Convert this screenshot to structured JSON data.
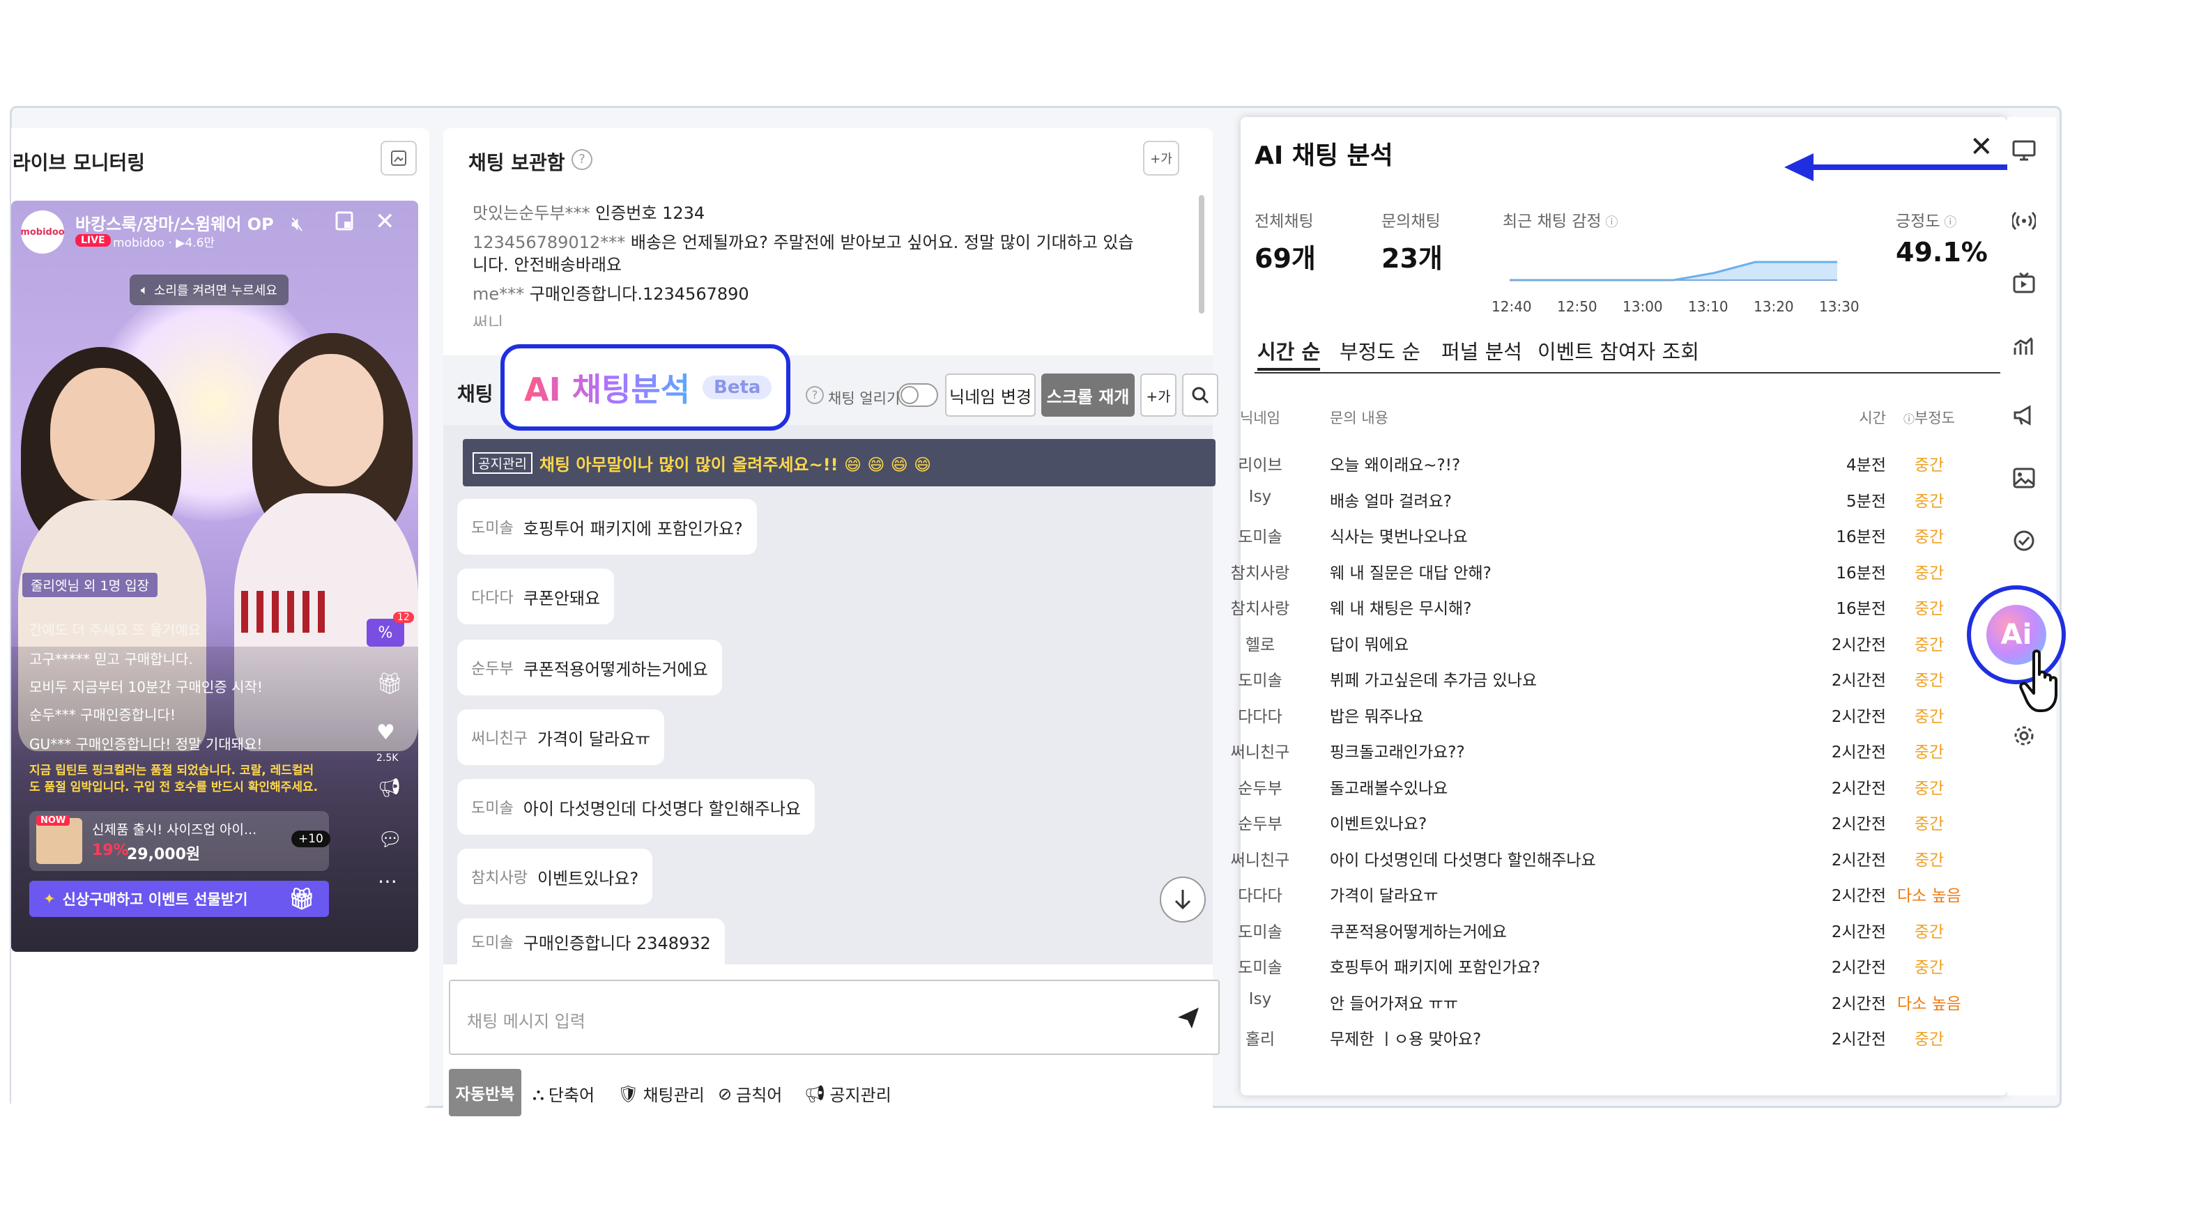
{
  "live": {
    "title": "라이브 모니터링",
    "stream_title": "바캉스룩/장마/스윔웨어 OP",
    "badge_live": "LIVE",
    "channel": "mobidoo · ▶4.6만",
    "logo_text": "mobidoo",
    "sound_hint": "소리를 켜려면 누르세요",
    "entry_note": "줄리엣님 외 1명 입장",
    "chats": [
      "간예도 더 주세요 또 올거예요",
      "고구*****  믿고 구매합니다.",
      "모비두  지금부터 10분간 구매인증 시작!",
      "순두***  구매인증합니다!",
      "GU***  구매인증합니다! 정말 기대돼요!"
    ],
    "notice": "지금 립틴트 핑크컬러는 품절 되었습니다. 코랄, 레드컬러도 품절 임박입니다. 구입 전 호수를 반드시 확인해주세요.",
    "badge_count": "12",
    "like_count": "2.5K",
    "product_new": "NOW",
    "product_name": "신제품 출시! 사이즈업 아이...",
    "product_discount": "19%",
    "product_price": "29,000원",
    "product_more": "+10",
    "event_button": "신상구매하고 이벤트 선물받기"
  },
  "chat_box": {
    "title": "채팅 보관함",
    "add_button": "+가",
    "messages": [
      {
        "nick": "맛있는순두부***",
        "text": "인증번호 1234"
      },
      {
        "nick": "123456789012***",
        "text": "배송은 언제될까요? 주말전에 받아보고 싶어요. 정말 많이 기대하고 있습니다. 안전배송바래요"
      },
      {
        "nick": "me***",
        "text": "구매인증합니다.1234567890"
      },
      {
        "nick": "써니",
        "text": ""
      }
    ]
  },
  "chat": {
    "title": "채팅",
    "ai_button": "AI 채팅분석",
    "beta": "Beta",
    "freeze_label": "채팅 얼리기",
    "nickname_button": "닉네임 변경",
    "scroll_button": "스크롤 재개",
    "font_button": "+가",
    "notice_tag": "공지관리",
    "notice_text": "채팅 아무말이나 많이 많이 올려주세요~!! 😄 😄 😄 😄",
    "bubbles": [
      {
        "nick": "도미솔",
        "text": "호핑투어 패키지에 포함인가요?"
      },
      {
        "nick": "다다다",
        "text": "쿠폰안돼요"
      },
      {
        "nick": "순두부",
        "text": "쿠폰적용어떻게하는거에요"
      },
      {
        "nick": "써니친구",
        "text": "가격이 달라요ㅠ"
      },
      {
        "nick": "도미솔",
        "text": "아이 다섯명인데 다섯명다 할인해주나요"
      },
      {
        "nick": "참치사랑",
        "text": "이벤트있나요?"
      },
      {
        "nick": "도미솔",
        "text": "구매인증합니다 2348932"
      }
    ],
    "input_placeholder": "채팅 메시지 입력",
    "bottom": {
      "auto_repeat": "자동반복",
      "shortcut": "단축어",
      "manage": "채팅관리",
      "banned": "금칙어",
      "notice": "공지관리"
    }
  },
  "ai": {
    "title": "AI 채팅 분석",
    "stats": {
      "total_label": "전체채팅",
      "total_value": "69개",
      "inquiry_label": "문의채팅",
      "inquiry_value": "23개",
      "sentiment_label": "최근 채팅 감정",
      "positive_label": "긍정도",
      "positive_value": "49.1%"
    },
    "sentiment_ticks": [
      "12:40",
      "12:50",
      "13:00",
      "13:10",
      "13:20",
      "13:30"
    ],
    "sentiment_series": [
      0,
      0,
      0,
      0,
      0,
      0.4,
      1,
      1,
      1
    ],
    "tabs": [
      "시간 순",
      "부정도 순",
      "퍼널 분석",
      "이벤트 참여자 조회"
    ],
    "columns": {
      "nick": "닉네임",
      "msg": "문의 내용",
      "time": "시간",
      "neg": "부정도"
    },
    "rows": [
      {
        "nick": "리이브",
        "msg": "오늘 왜이래요~?!?",
        "time": "4분전",
        "neg": "중간"
      },
      {
        "nick": "Isy",
        "msg": "배송 얼마 걸려요?",
        "time": "5분전",
        "neg": "중간"
      },
      {
        "nick": "도미솔",
        "msg": "식사는 몇번나오나요",
        "time": "16분전",
        "neg": "중간"
      },
      {
        "nick": "참치사랑",
        "msg": "웨 내 질문은 대답 안해?",
        "time": "16분전",
        "neg": "중간"
      },
      {
        "nick": "참치사랑",
        "msg": "웨 내 채팅은 무시해?",
        "time": "16분전",
        "neg": "중간"
      },
      {
        "nick": "헬로",
        "msg": "답이 뭐에요",
        "time": "2시간전",
        "neg": "중간"
      },
      {
        "nick": "도미솔",
        "msg": "뷔페 가고싶은데 추가금 있나요",
        "time": "2시간전",
        "neg": "중간"
      },
      {
        "nick": "다다다",
        "msg": "밥은 뭐주나요",
        "time": "2시간전",
        "neg": "중간"
      },
      {
        "nick": "써니친구",
        "msg": "핑크돌고래인가요??",
        "time": "2시간전",
        "neg": "중간"
      },
      {
        "nick": "순두부",
        "msg": "돌고래볼수있나요",
        "time": "2시간전",
        "neg": "중간"
      },
      {
        "nick": "순두부",
        "msg": "이벤트있나요?",
        "time": "2시간전",
        "neg": "중간"
      },
      {
        "nick": "써니친구",
        "msg": "아이 다섯명인데 다섯명다 할인해주나요",
        "time": "2시간전",
        "neg": "중간"
      },
      {
        "nick": "다다다",
        "msg": "가격이 달라요ㅠ",
        "time": "2시간전",
        "neg": "다소 높음"
      },
      {
        "nick": "도미솔",
        "msg": "쿠폰적용어떻게하는거에요",
        "time": "2시간전",
        "neg": "중간"
      },
      {
        "nick": "도미솔",
        "msg": "호핑투어 패키지에 포함인가요?",
        "time": "2시간전",
        "neg": "중간"
      },
      {
        "nick": "Isy",
        "msg": "안 들어가져요 ㅠㅠ",
        "time": "2시간전",
        "neg": "다소 높음"
      },
      {
        "nick": "홀리",
        "msg": "무제한 ㅣㅇ용 맞아요?",
        "time": "2시간전",
        "neg": "중간"
      }
    ],
    "fab_label": "Ai"
  },
  "colors": {
    "accent_blue": "#1f2fe0",
    "neg_mid": "#f0a020",
    "neg_high": "#f07a10",
    "notice_bg": "#4a4f66",
    "notice_text": "#ffd84a"
  }
}
